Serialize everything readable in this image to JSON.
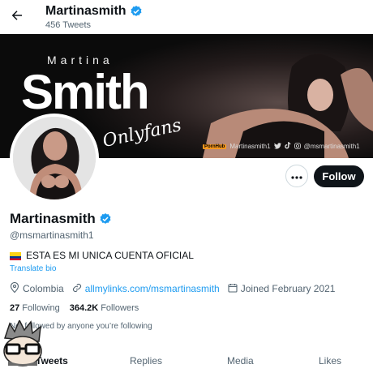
{
  "header": {
    "name": "Martinasmith",
    "tweet_count": "456 Tweets",
    "back_icon": "arrow-left-icon",
    "verified_icon": "verified-badge-icon"
  },
  "banner": {
    "first": "Martina",
    "last": "Smith",
    "script": "Onlyfans",
    "social": {
      "pornhub_badge": "PornHub",
      "pornhub_handle": "Martinasmith1",
      "other_handle": "@msmartinasmith1"
    }
  },
  "actions": {
    "more_icon": "more-dots-icon",
    "follow_label": "Follow"
  },
  "profile": {
    "name": "Martinasmith",
    "handle": "@msmartinasmith1",
    "bio": "ESTA ES MI UNICA CUENTA OFICIAL",
    "translate_label": "Translate bio",
    "location": "Colombia",
    "link": "allmylinks.com/msmartinasmith",
    "joined": "Joined February 2021",
    "following_count": "27",
    "following_label": "Following",
    "followers_count": "364.2K",
    "followers_label": "Followers",
    "followed_note": "Not followed by anyone you’re following"
  },
  "tabs": [
    "Tweets",
    "Replies",
    "Media",
    "Likes"
  ],
  "colors": {
    "accent": "#1d9bf0",
    "text": "#0f1419",
    "muted": "#536471",
    "follow_bg": "#0f1419"
  }
}
